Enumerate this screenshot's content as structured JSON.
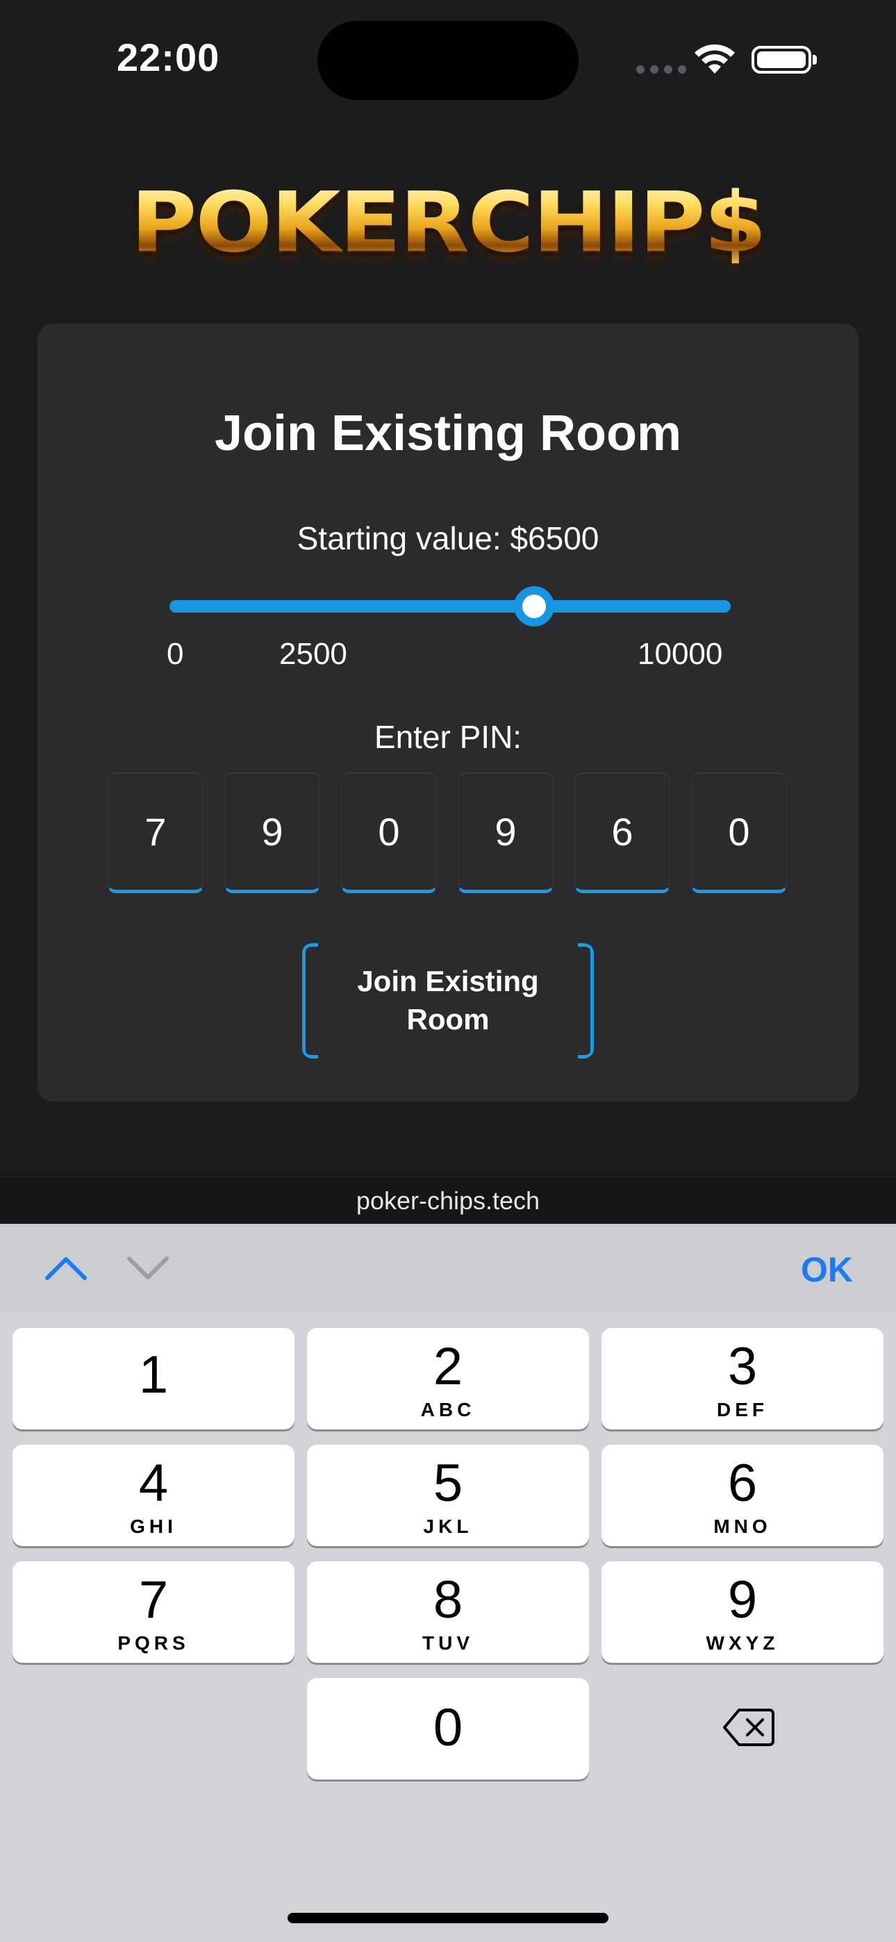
{
  "status_bar": {
    "time": "22:00"
  },
  "app": {
    "logo_text": "POKERCHIP$",
    "accent_color": "#1a9be6",
    "gold_color": "#f5c14a"
  },
  "card": {
    "title": "Join Existing Room",
    "starting_value_label": "Starting value: $6500",
    "slider": {
      "value": 6500,
      "min_label": "0",
      "mid_label": "2500",
      "max_label": "10000"
    },
    "pin_label": "Enter PIN:",
    "pin_digits": [
      "7",
      "9",
      "0",
      "9",
      "6",
      "0"
    ],
    "join_button_label": "Join Existing Room"
  },
  "url_bar": {
    "domain": "poker-chips.tech"
  },
  "keyboard": {
    "ok_label": "OK",
    "keys": [
      {
        "digit": "1",
        "letters": ""
      },
      {
        "digit": "2",
        "letters": "ABC"
      },
      {
        "digit": "3",
        "letters": "DEF"
      },
      {
        "digit": "4",
        "letters": "GHI"
      },
      {
        "digit": "5",
        "letters": "JKL"
      },
      {
        "digit": "6",
        "letters": "MNO"
      },
      {
        "digit": "7",
        "letters": "PQRS"
      },
      {
        "digit": "8",
        "letters": "TUV"
      },
      {
        "digit": "9",
        "letters": "WXYZ"
      },
      {
        "digit": "0",
        "letters": ""
      }
    ],
    "icons": {
      "previous": "chevron-up-icon",
      "next": "chevron-down-icon",
      "delete": "backspace-icon"
    }
  }
}
